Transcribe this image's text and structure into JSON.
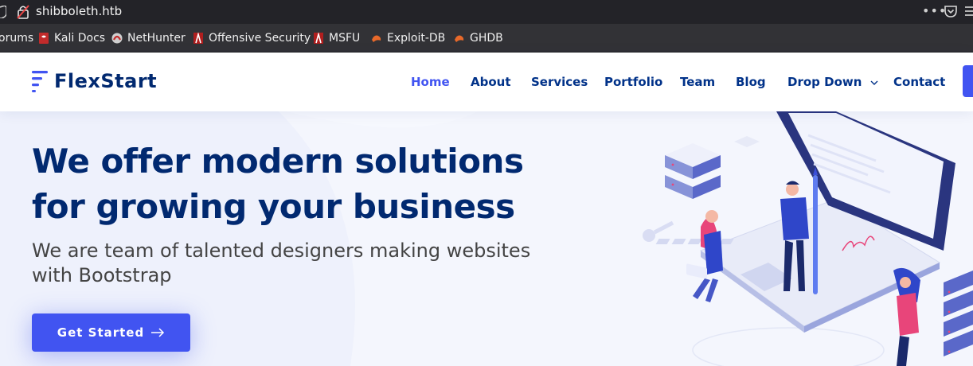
{
  "browser": {
    "url": "shibboleth.htb",
    "more_label": "•••"
  },
  "bookmarks": [
    {
      "label": "orums",
      "icon": "forum-icon"
    },
    {
      "label": "Kali Docs",
      "icon": "kali-docs-icon"
    },
    {
      "label": "NetHunter",
      "icon": "nethunter-icon"
    },
    {
      "label": "Offensive Security",
      "icon": "offsec-icon"
    },
    {
      "label": "MSFU",
      "icon": "msfu-icon"
    },
    {
      "label": "Exploit-DB",
      "icon": "exploit-db-icon"
    },
    {
      "label": "GHDB",
      "icon": "ghdb-icon"
    }
  ],
  "site": {
    "brand": "FlexStart",
    "nav": [
      {
        "label": "Home",
        "active": true
      },
      {
        "label": "About"
      },
      {
        "label": "Services"
      },
      {
        "label": "Portfolio"
      },
      {
        "label": "Team"
      },
      {
        "label": "Blog"
      },
      {
        "label": "Drop Down",
        "has_dropdown": true
      },
      {
        "label": "Contact"
      }
    ]
  },
  "hero": {
    "title_line1": "We offer modern solutions",
    "title_line2": "for growing your business",
    "subtitle": "We are team of talented designers making websites with Bootstrap",
    "cta_label": "Get Started"
  },
  "colors": {
    "brand_dark": "#012970",
    "accent": "#4154f1",
    "browser_bg": "#232328",
    "bookmarks_bg": "#323236"
  }
}
